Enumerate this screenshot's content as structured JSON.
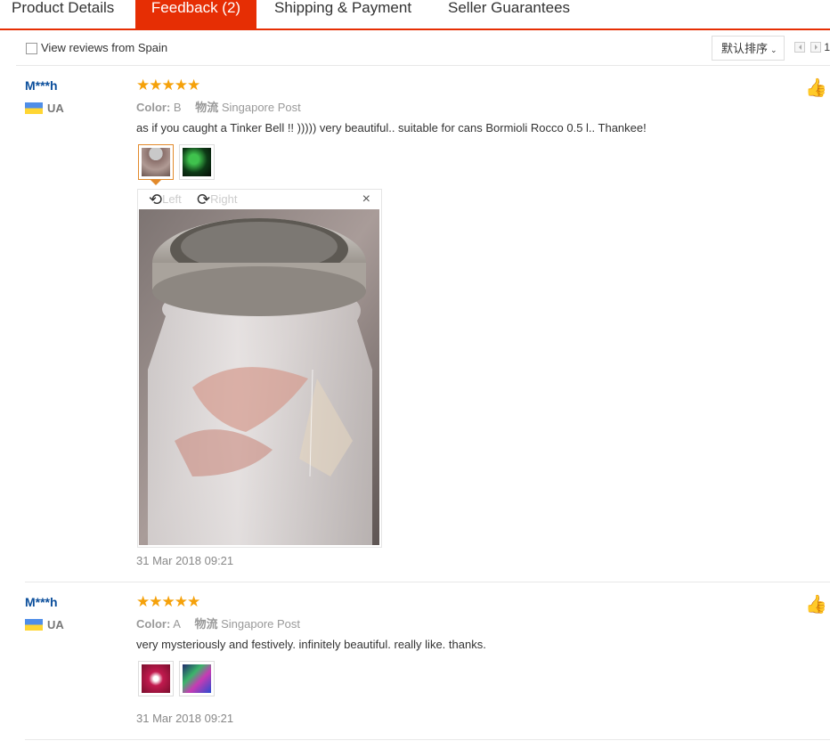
{
  "tabs": [
    {
      "label": "Product Details",
      "active": false
    },
    {
      "label": "Feedback (2)",
      "active": true
    },
    {
      "label": "Shipping & Payment",
      "active": false
    },
    {
      "label": "Seller Guarantees",
      "active": false
    }
  ],
  "filter": {
    "checkbox_label": "View reviews from Spain",
    "sort_label": "默认排序",
    "page_number": "1"
  },
  "viewer": {
    "rotate_left_label": "Left",
    "rotate_right_label": "Right",
    "close_icon": "×"
  },
  "reviews": [
    {
      "user": "M***h",
      "country": "UA",
      "stars": "★★★★★",
      "rating": 5,
      "color_label": "Color:",
      "color_value": "B",
      "shipping_label": "物流",
      "shipping_value": "Singapore Post",
      "text": "as if you caught a Tinker Bell !! ))))) very beautiful.. suitable for cans Bormioli Rocco 0.5 l.. Thankee!",
      "date": "31 Mar 2018 09:21"
    },
    {
      "user": "M***h",
      "country": "UA",
      "stars": "★★★★★",
      "rating": 5,
      "color_label": "Color:",
      "color_value": "A",
      "shipping_label": "物流",
      "shipping_value": "Singapore Post",
      "text": "very mysteriously and festively. infinitely beautiful. really like. thanks.",
      "date": "31 Mar 2018 09:21"
    }
  ],
  "colors": {
    "accent": "#e62e04",
    "star": "#f5a10a",
    "username": "#0c4f9c"
  }
}
